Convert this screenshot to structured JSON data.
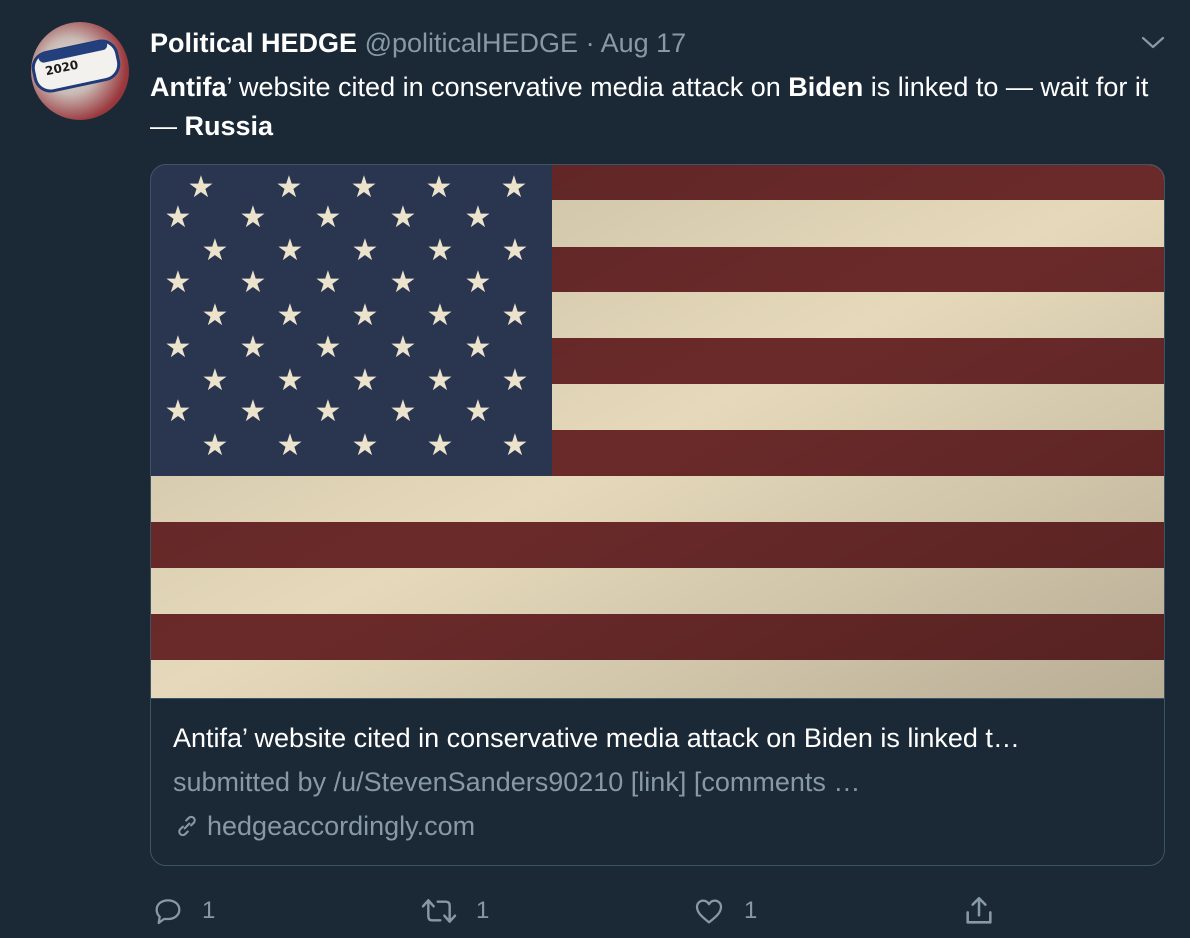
{
  "tweet": {
    "display_name": "Political HEDGE",
    "handle": "@politicalHEDGE",
    "separator": "·",
    "date": "Aug 17",
    "avatar_badge_text": "2020",
    "text_segments": [
      {
        "text": "Antifa",
        "bold": true
      },
      {
        "text": "’ website cited in conservative media attack on ",
        "bold": false
      },
      {
        "text": "Biden",
        "bold": true
      },
      {
        "text": " is linked to — wait for it — ",
        "bold": false
      },
      {
        "text": "Russia",
        "bold": true
      }
    ]
  },
  "card": {
    "title": "Antifa’ website cited in conservative media attack on Biden is linked t…",
    "description": "submitted by /u/StevenSanders90210 [link] [comments …",
    "domain": "hedgeaccordingly.com",
    "image_icon": "american-flag-image"
  },
  "actions": {
    "reply": {
      "icon": "reply-icon",
      "count": "1"
    },
    "retweet": {
      "icon": "retweet-icon",
      "count": "1"
    },
    "like": {
      "icon": "heart-icon",
      "count": "1"
    },
    "share": {
      "icon": "share-icon"
    }
  },
  "colors": {
    "background": "#1b2836",
    "secondary_text": "#8899a6",
    "border": "#3d5466",
    "flag_canton": "#2a3550",
    "flag_red": "#6b2a2a",
    "flag_white": "#e8dcc0"
  }
}
